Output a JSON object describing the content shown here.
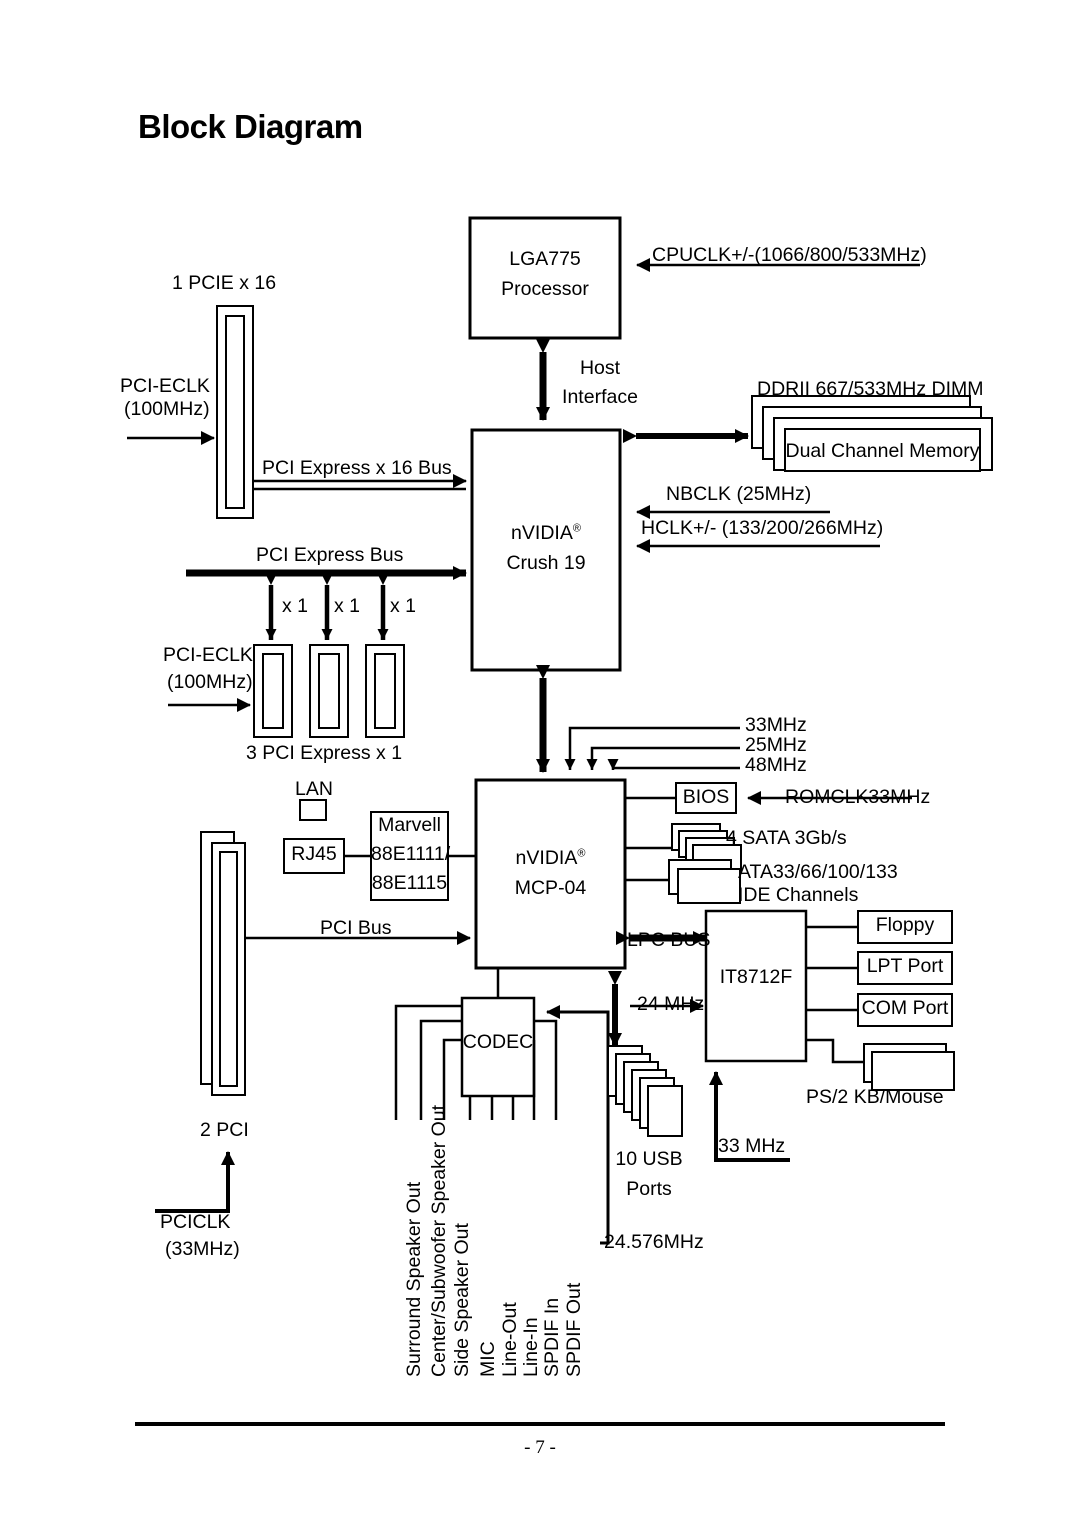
{
  "page": {
    "title": "Block Diagram",
    "footer_page_number": "- 7 -"
  },
  "blocks": {
    "cpu": {
      "line1": "LGA775",
      "line2": "Processor"
    },
    "northbridge": {
      "line1": "nVIDIA",
      "reg": "®",
      "line2": "Crush 19"
    },
    "southbridge": {
      "line1": "nVIDIA",
      "reg": "®",
      "line2": "MCP-04"
    },
    "memory": {
      "label": "Dual Channel Memory",
      "caption": "DDRII 667/533MHz DIMM"
    },
    "bios": {
      "label": "BIOS"
    },
    "codec": {
      "label": "CODEC"
    },
    "superio": {
      "label": "IT8712F"
    },
    "lan_phy": {
      "line1": "Marvell",
      "line2": "88E1111/",
      "line3": "88E1115"
    },
    "rj45": {
      "label": "RJ45",
      "caption": "LAN"
    },
    "floppy": {
      "label": "Floppy"
    },
    "lpt": {
      "label": "LPT Port"
    },
    "com": {
      "label": "COM Port"
    },
    "ps2": {
      "caption": "PS/2 KB/Mouse"
    },
    "sata": {
      "label": "4 SATA 3Gb/s"
    },
    "ide": {
      "line1": "ATA33/66/100/133",
      "line2": "IDE Channels"
    },
    "usb": {
      "line1": "10 USB",
      "line2": "Ports"
    },
    "pcie16_slot": {
      "caption": "1 PCIE x 16"
    },
    "pcie1_slots": {
      "caption": "3 PCI Express x 1",
      "lane": "x 1"
    },
    "pci_slots": {
      "caption": "2 PCI"
    }
  },
  "buses": {
    "pcie_x16": "PCI Express x 16 Bus",
    "pcie": "PCI Express Bus",
    "pci": "PCI Bus",
    "host_interface_l1": "Host",
    "host_interface_l2": "Interface",
    "lpc": "LPC BUS"
  },
  "clocks": {
    "cpuclk": "CPUCLK+/-(1066/800/533MHz)",
    "nbclk": "NBCLK (25MHz)",
    "hclk": "HCLK+/- (133/200/266MHz)",
    "pci_eclk_top_l1": "PCI-ECLK",
    "pci_eclk_top_l2": "(100MHz)",
    "pci_eclk_mid_l1": "PCI-ECLK",
    "pci_eclk_mid_l2": "(100MHz)",
    "sb_33mhz": "33MHz",
    "sb_25mhz": "25MHz",
    "sb_48mhz": "48MHz",
    "romclk": "ROMCLK33MHz",
    "sio_24mhz": "24 MHz",
    "sio_33mhz": "33 MHz",
    "codec_clk": "24.576MHz",
    "pciclk_l1": "PCICLK",
    "pciclk_l2": "(33MHz)"
  },
  "audio_jacks": [
    "Surround Speaker Out",
    "Center/Subwoofer Speaker Out",
    "Side Speaker Out",
    "MIC",
    "Line-Out",
    "Line-In",
    "SPDIF In",
    "SPDIF Out"
  ],
  "colors": {
    "line": "#000000",
    "background": "#ffffff"
  }
}
